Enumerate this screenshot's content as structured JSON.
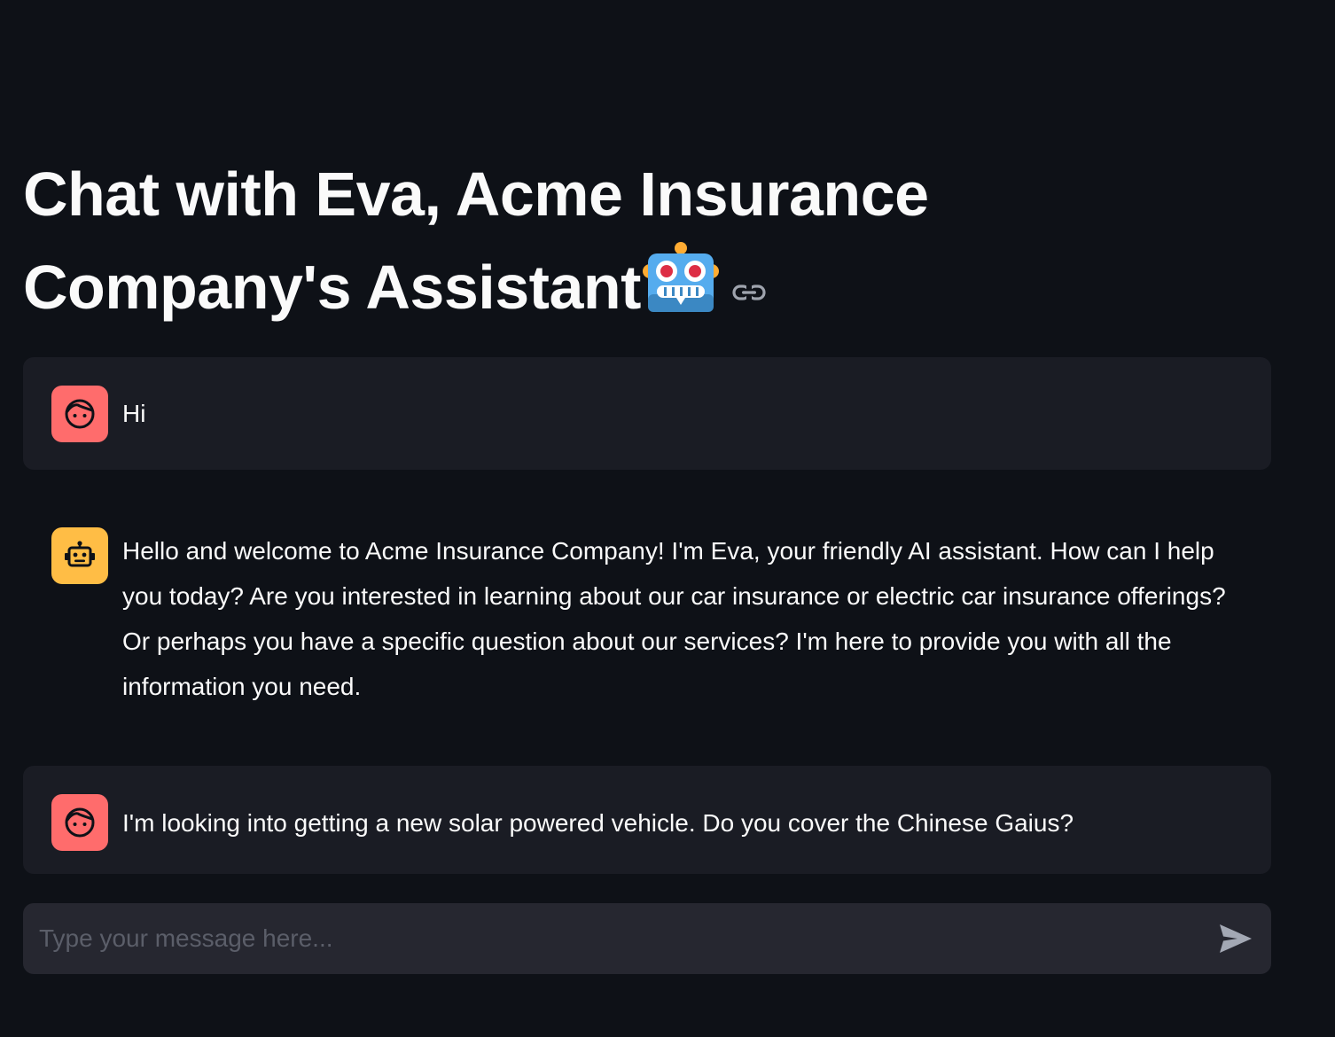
{
  "page": {
    "title": "Chat with Eva, Acme Insurance Company's Assistant",
    "title_emoji": "robot-emoji",
    "anchor_icon": "link-icon"
  },
  "colors": {
    "background": "#0e1117",
    "user_bubble": "#1a1c24",
    "user_avatar": "#ff6c6c",
    "assistant_avatar": "#ffbd45",
    "input_background": "#262730",
    "text": "#fafafa"
  },
  "messages": [
    {
      "role": "user",
      "avatar_icon": "user-face-icon",
      "text": "Hi"
    },
    {
      "role": "assistant",
      "avatar_icon": "bot-icon",
      "text": "Hello and welcome to Acme Insurance Company! I'm Eva, your friendly AI assistant. How can I help you today? Are you interested in learning about our car insurance or electric car insurance offerings? Or perhaps you have a specific question about our services? I'm here to provide you with all the information you need."
    },
    {
      "role": "user",
      "avatar_icon": "user-face-icon",
      "text": "I'm looking into getting a new solar powered vehicle. Do you cover the Chinese Gaius?"
    }
  ],
  "chat_input": {
    "placeholder": "Type your message here...",
    "value": "",
    "send_icon": "send-icon"
  }
}
